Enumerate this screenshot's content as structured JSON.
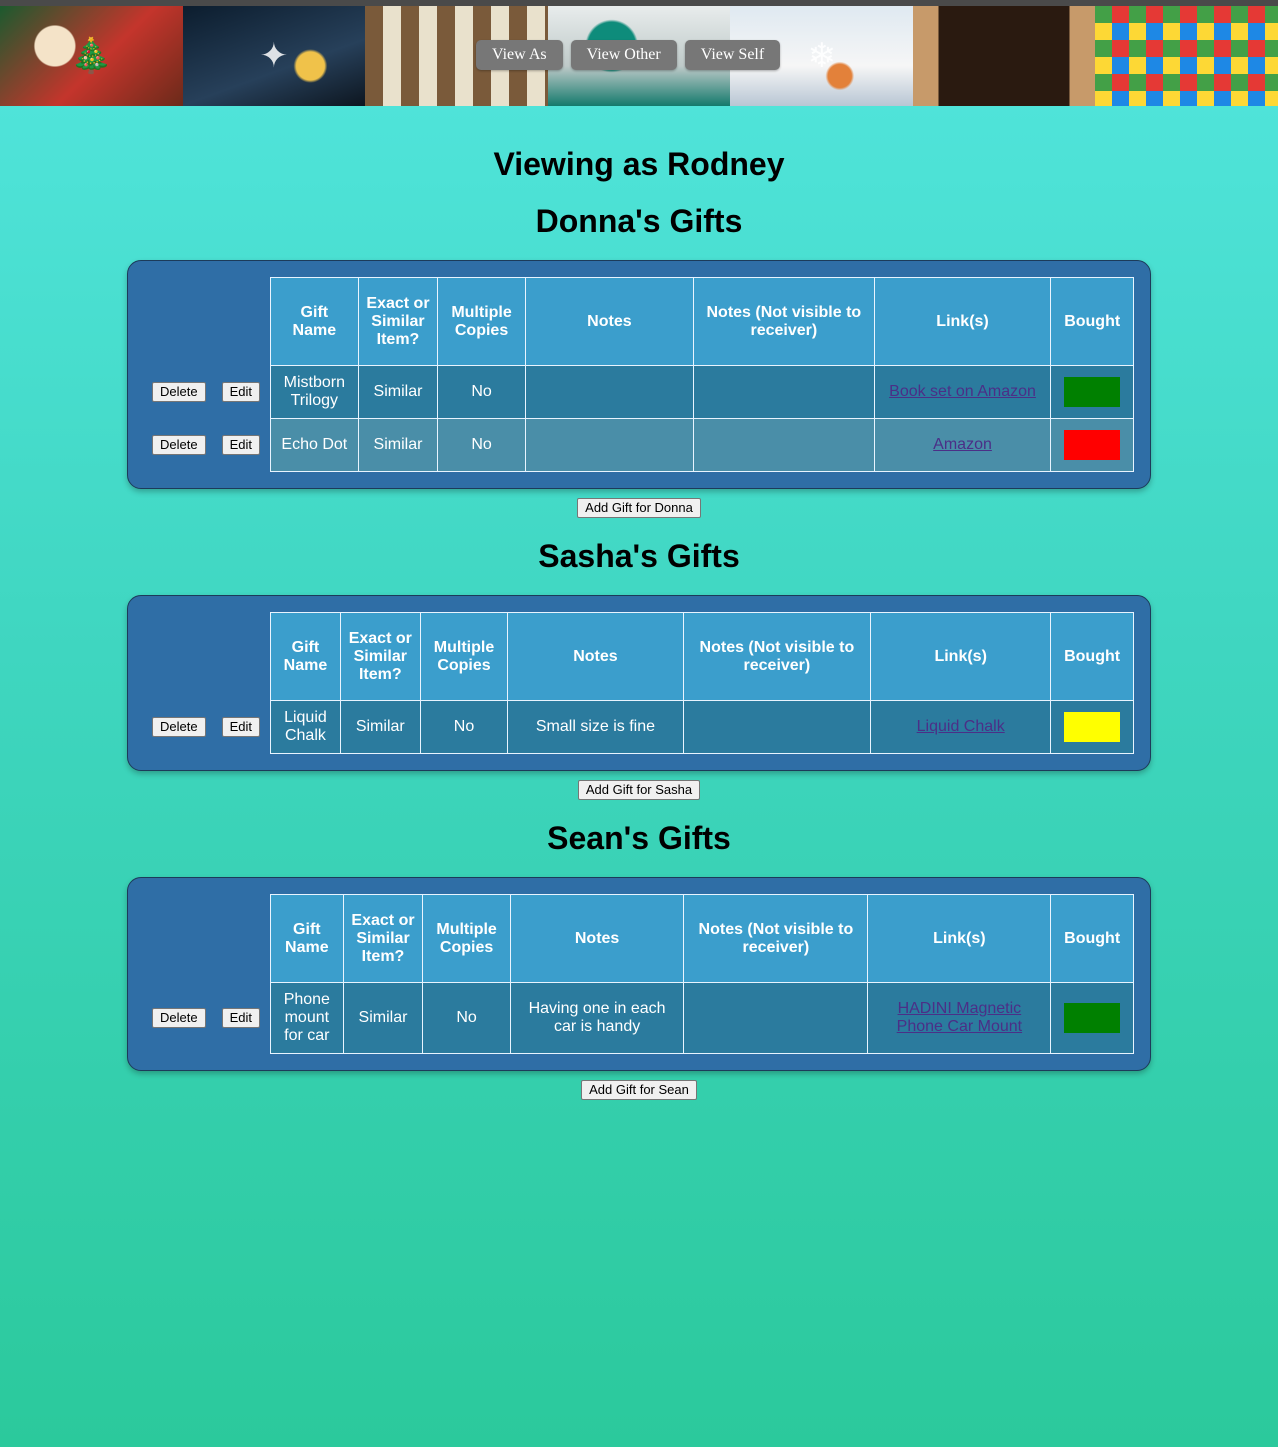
{
  "nav": {
    "view_as": "View As",
    "view_other": "View Other",
    "view_self": "View Self"
  },
  "viewing_title": "Viewing as Rodney",
  "headers": {
    "gift_name": "Gift Name",
    "exact_or_similar": "Exact or Similar Item?",
    "multiple_copies": "Multiple Copies",
    "notes": "Notes",
    "notes_hidden": "Notes (Not visible to receiver)",
    "links": "Link(s)",
    "bought": "Bought"
  },
  "buttons": {
    "delete": "Delete",
    "edit": "Edit"
  },
  "sections": [
    {
      "title": "Donna's Gifts",
      "add_label": "Add Gift for Donna",
      "gifts": [
        {
          "name": "Mistborn Trilogy",
          "exact_or_similar": "Similar",
          "multiple": "No",
          "notes": "",
          "notes_hidden": "",
          "link": "Book set on Amazon",
          "bought_color": "#008000"
        },
        {
          "name": "Echo Dot",
          "exact_or_similar": "Similar",
          "multiple": "No",
          "notes": "",
          "notes_hidden": "",
          "link": "Amazon",
          "bought_color": "#ff0000"
        }
      ]
    },
    {
      "title": "Sasha's Gifts",
      "add_label": "Add Gift for Sasha",
      "gifts": [
        {
          "name": "Liquid Chalk",
          "exact_or_similar": "Similar",
          "multiple": "No",
          "notes": "Small size is fine",
          "notes_hidden": "",
          "link": "Liquid Chalk",
          "bought_color": "#ffff00"
        }
      ]
    },
    {
      "title": "Sean's Gifts",
      "add_label": "Add Gift for Sean",
      "gifts": [
        {
          "name": "Phone mount for car",
          "exact_or_similar": "Similar",
          "multiple": "No",
          "notes": "Having one in each car is handy",
          "notes_hidden": "",
          "link": "HADINI Magnetic Phone Car Mount",
          "bought_color": "#008000"
        }
      ]
    }
  ]
}
